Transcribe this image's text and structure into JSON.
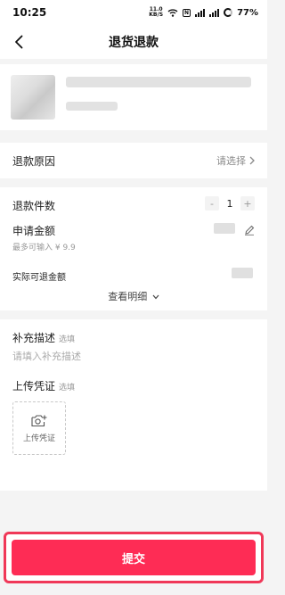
{
  "status_bar": {
    "time": "10:25",
    "net_speed_value": "11.0",
    "net_speed_unit": "KB/S",
    "nfc": "N",
    "battery": "77%"
  },
  "nav": {
    "title": "退货退款"
  },
  "reason": {
    "label": "退款原因",
    "placeholder": "请选择"
  },
  "amount": {
    "quantity_label": "退款件数",
    "quantity_minus": "-",
    "quantity_value": "1",
    "quantity_plus": "+",
    "apply_label": "申请金额",
    "max_hint": "最多可输入 ¥ 9.9",
    "actual_label": "实际可退金额",
    "view_detail": "查看明细"
  },
  "description": {
    "title": "补充描述",
    "optional": "选填",
    "placeholder": "请填入补充描述"
  },
  "voucher": {
    "title": "上传凭证",
    "optional": "选填",
    "upload_label": "上传凭证"
  },
  "submit": {
    "label": "提交"
  },
  "colors": {
    "accent": "#fe2c55",
    "page_bg": "#f4f4f4"
  }
}
